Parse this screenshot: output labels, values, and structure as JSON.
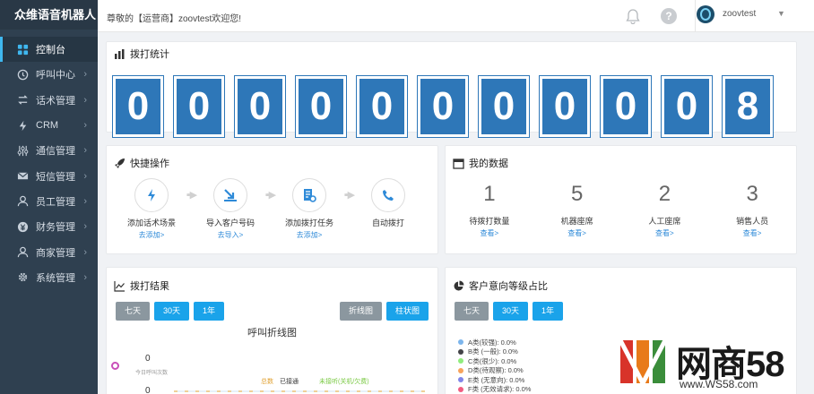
{
  "app": {
    "brand": "众维语音机器人"
  },
  "sidebar": {
    "items": [
      {
        "label": "控制台",
        "icon": "dashboard-icon"
      },
      {
        "label": "呼叫中心",
        "icon": "clock-icon"
      },
      {
        "label": "话术管理",
        "icon": "swap-icon"
      },
      {
        "label": "CRM",
        "icon": "bolt-icon"
      },
      {
        "label": "通信管理",
        "icon": "sliders-icon"
      },
      {
        "label": "短信管理",
        "icon": "mail-icon"
      },
      {
        "label": "员工管理",
        "icon": "user-icon"
      },
      {
        "label": "财务管理",
        "icon": "money-icon"
      },
      {
        "label": "商家管理",
        "icon": "person-icon"
      },
      {
        "label": "系统管理",
        "icon": "gear-icon"
      }
    ]
  },
  "topbar": {
    "welcome": "尊敬的【运营商】zoovtest欢迎您!",
    "username": "zoovtest"
  },
  "dial_stats": {
    "title": "拨打统计",
    "digits": [
      "0",
      "0",
      "0",
      "0",
      "0",
      "0",
      "0",
      "0",
      "0",
      "0",
      "8"
    ]
  },
  "quick": {
    "title": "快捷操作",
    "steps": [
      {
        "label": "添加话术场景",
        "link": "去添加>"
      },
      {
        "label": "导入客户号码",
        "link": "去导入>"
      },
      {
        "label": "添加拨打任务",
        "link": "去添加>"
      },
      {
        "label": "自动拨打",
        "link": ""
      }
    ]
  },
  "my_data": {
    "title": "我的数据",
    "stats": [
      {
        "value": "1",
        "label": "待拨打数量",
        "link": "查看>"
      },
      {
        "value": "5",
        "label": "机器座席",
        "link": "查看>"
      },
      {
        "value": "2",
        "label": "人工座席",
        "link": "查看>"
      },
      {
        "value": "3",
        "label": "销售人员",
        "link": "查看>"
      }
    ]
  },
  "results": {
    "title": "拨打结果",
    "ranges": [
      "七天",
      "30天",
      "1年"
    ],
    "views": [
      "折线图",
      "柱状图"
    ],
    "chart_title": "呼叫折线图",
    "left_value": "0",
    "left_sub": "今日呼叫次数",
    "left_value2": "0",
    "legend": [
      "总数",
      "已接通",
      "未接听(关机/欠费)"
    ],
    "legend_colors": [
      "#e0a030",
      "#333333",
      "#7ac943"
    ]
  },
  "intent": {
    "title": "客户意向等级占比",
    "ranges": [
      "七天",
      "30天",
      "1年"
    ],
    "levels": [
      {
        "label": "A类(较强): 0.0%",
        "color": "#7cb5ec"
      },
      {
        "label": "B类 (一般): 0.0%",
        "color": "#434348"
      },
      {
        "label": "C类(很少): 0.0%",
        "color": "#90ed7d"
      },
      {
        "label": "D类(待观察): 0.0%",
        "color": "#f7a35c"
      },
      {
        "label": "E类 (无意向): 0.0%",
        "color": "#8085e9"
      },
      {
        "label": "F类 (无效请求): 0.0%",
        "color": "#f15c80"
      }
    ]
  },
  "watermark": {
    "name": "网商58",
    "url": "www.WS58.com"
  }
}
